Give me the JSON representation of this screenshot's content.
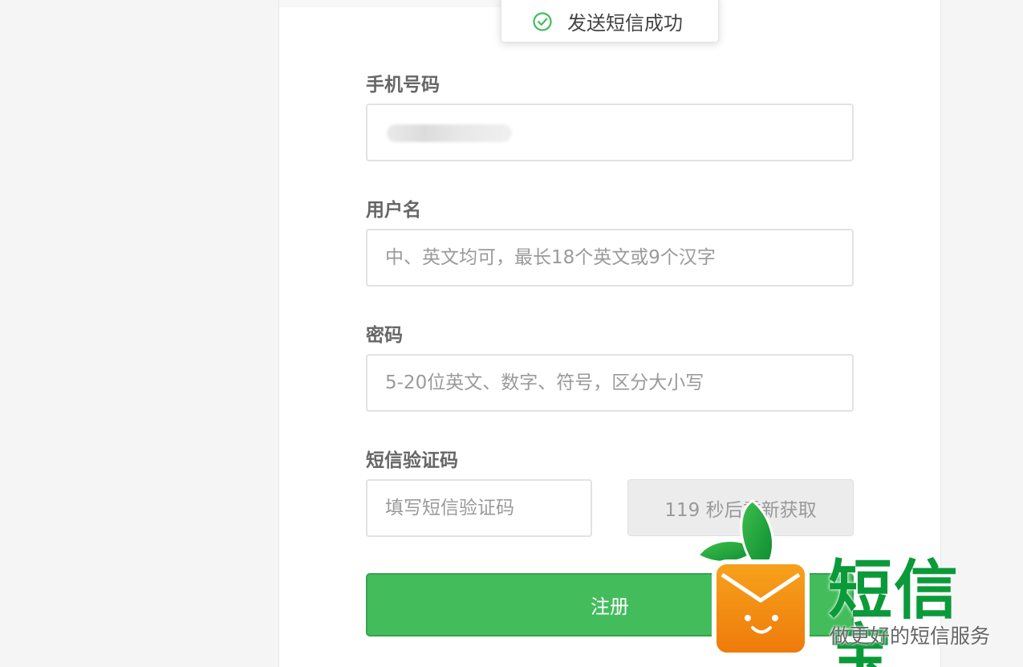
{
  "toast": {
    "message": "发送短信成功",
    "icon": "check-circle-icon",
    "icon_color": "#43bd5c"
  },
  "form": {
    "phone": {
      "label": "手机号码",
      "value": ""
    },
    "username": {
      "label": "用户名",
      "placeholder": "中、英文均可，最长18个英文或9个汉字"
    },
    "password": {
      "label": "密码",
      "placeholder": "5-20位英文、数字、符号，区分大小写"
    },
    "sms_code": {
      "label": "短信验证码",
      "placeholder": "填写短信验证码",
      "resend_label": "119 秒后重新获取"
    },
    "submit_label": "注册"
  },
  "brand": {
    "name": "短信宝",
    "slogan": "做更好的短信服务",
    "logo_icon": "smiling-bag-mascot-icon",
    "color": "#0b9a3a"
  }
}
